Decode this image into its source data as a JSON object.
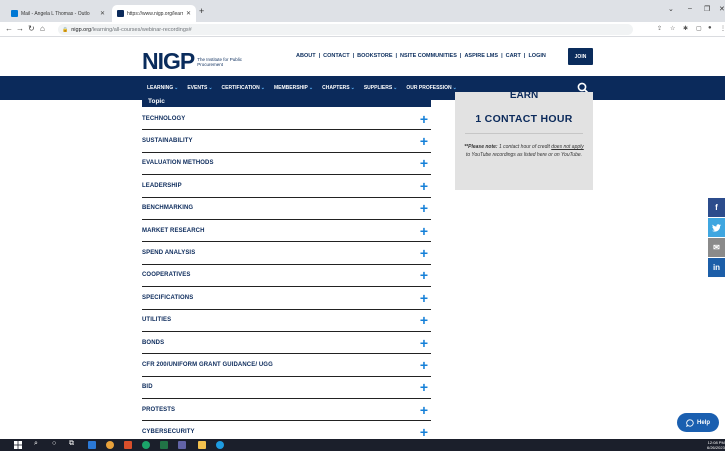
{
  "browser": {
    "tabs": [
      {
        "title": "Mail - Angela L Thomas - Outlo",
        "favicon_color": "#0078d4"
      },
      {
        "title": "https://www.nigp.org/learning/w",
        "favicon_color": "#0b2a5b"
      }
    ],
    "url_domain": "nigp.org",
    "url_path": "/learning/all-courses/webinar-recordings#"
  },
  "site": {
    "logo_text": "NIGP",
    "logo_tagline": "The Institute for Public Procurement",
    "top_links": [
      "ABOUT",
      "CONTACT",
      "BOOKSTORE",
      "NSITE COMMUNITIES",
      "ASPIRE LMS",
      "CART",
      "LOGIN"
    ],
    "join_label": "JOIN",
    "main_nav": [
      {
        "label": "LEARNING",
        "chevron": "⌄"
      },
      {
        "label": "EVENTS",
        "chevron": "⌄"
      },
      {
        "label": "CERTIFICATION",
        "chevron": "⌄"
      },
      {
        "label": "MEMBERSHIP",
        "chevron": "⌄"
      },
      {
        "label": "CHAPTERS",
        "chevron": "⌄"
      },
      {
        "label": "SUPPLIERS",
        "chevron": "⌄"
      },
      {
        "label": "OUR PROFESSION",
        "chevron": "⌄"
      }
    ]
  },
  "topics": {
    "header": "Topic",
    "items": [
      "TECHNOLOGY",
      "SUSTAINABILITY",
      "EVALUATION METHODS",
      "LEADERSHIP",
      "BENCHMARKING",
      "MARKET RESEARCH",
      "SPEND ANALYSIS",
      "COOPERATIVES",
      "SPECIFICATIONS",
      "UTILITIES",
      "BONDS",
      "CFR 200/UNIFORM GRANT GUIDANCE/ UGG",
      "BID",
      "PROTESTS",
      "CYBERSECURITY"
    ],
    "expand_symbol": "+"
  },
  "earn_panel": {
    "earn": "EARN",
    "contact_hour": "1 CONTACT HOUR",
    "note_bold": "**Please note:",
    "note_rest1": " 1 contact hour of credit ",
    "note_underlined": "does not apply",
    "note_rest2": " to YouTube recordings as listed here or on YouTube."
  },
  "social": {
    "facebook": "f",
    "twitter": "t",
    "email": "✉",
    "linkedin": "in"
  },
  "help_label": "Help",
  "clock": {
    "time": "12:08 PM",
    "date": "6/26/2023"
  },
  "colors": {
    "brand_navy": "#0b2a5b",
    "accent_blue": "#1580d8"
  }
}
